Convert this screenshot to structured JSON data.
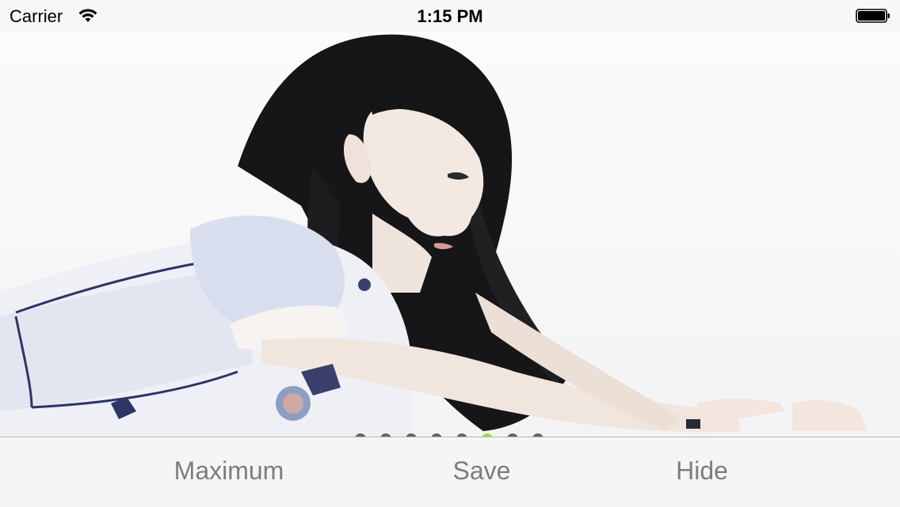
{
  "status_bar": {
    "carrier": "Carrier",
    "time": "1:15 PM",
    "wifi_icon": "wifi-icon",
    "battery_icon": "battery-icon"
  },
  "photo": {
    "page_control": {
      "total": 8,
      "current": 6,
      "active_color": "#9fdc3a",
      "inactive_color": "#4a4a4a"
    }
  },
  "toolbar": {
    "maximum_label": "Maximum",
    "save_label": "Save",
    "hide_label": "Hide",
    "text_color": "#7d7d7d"
  }
}
